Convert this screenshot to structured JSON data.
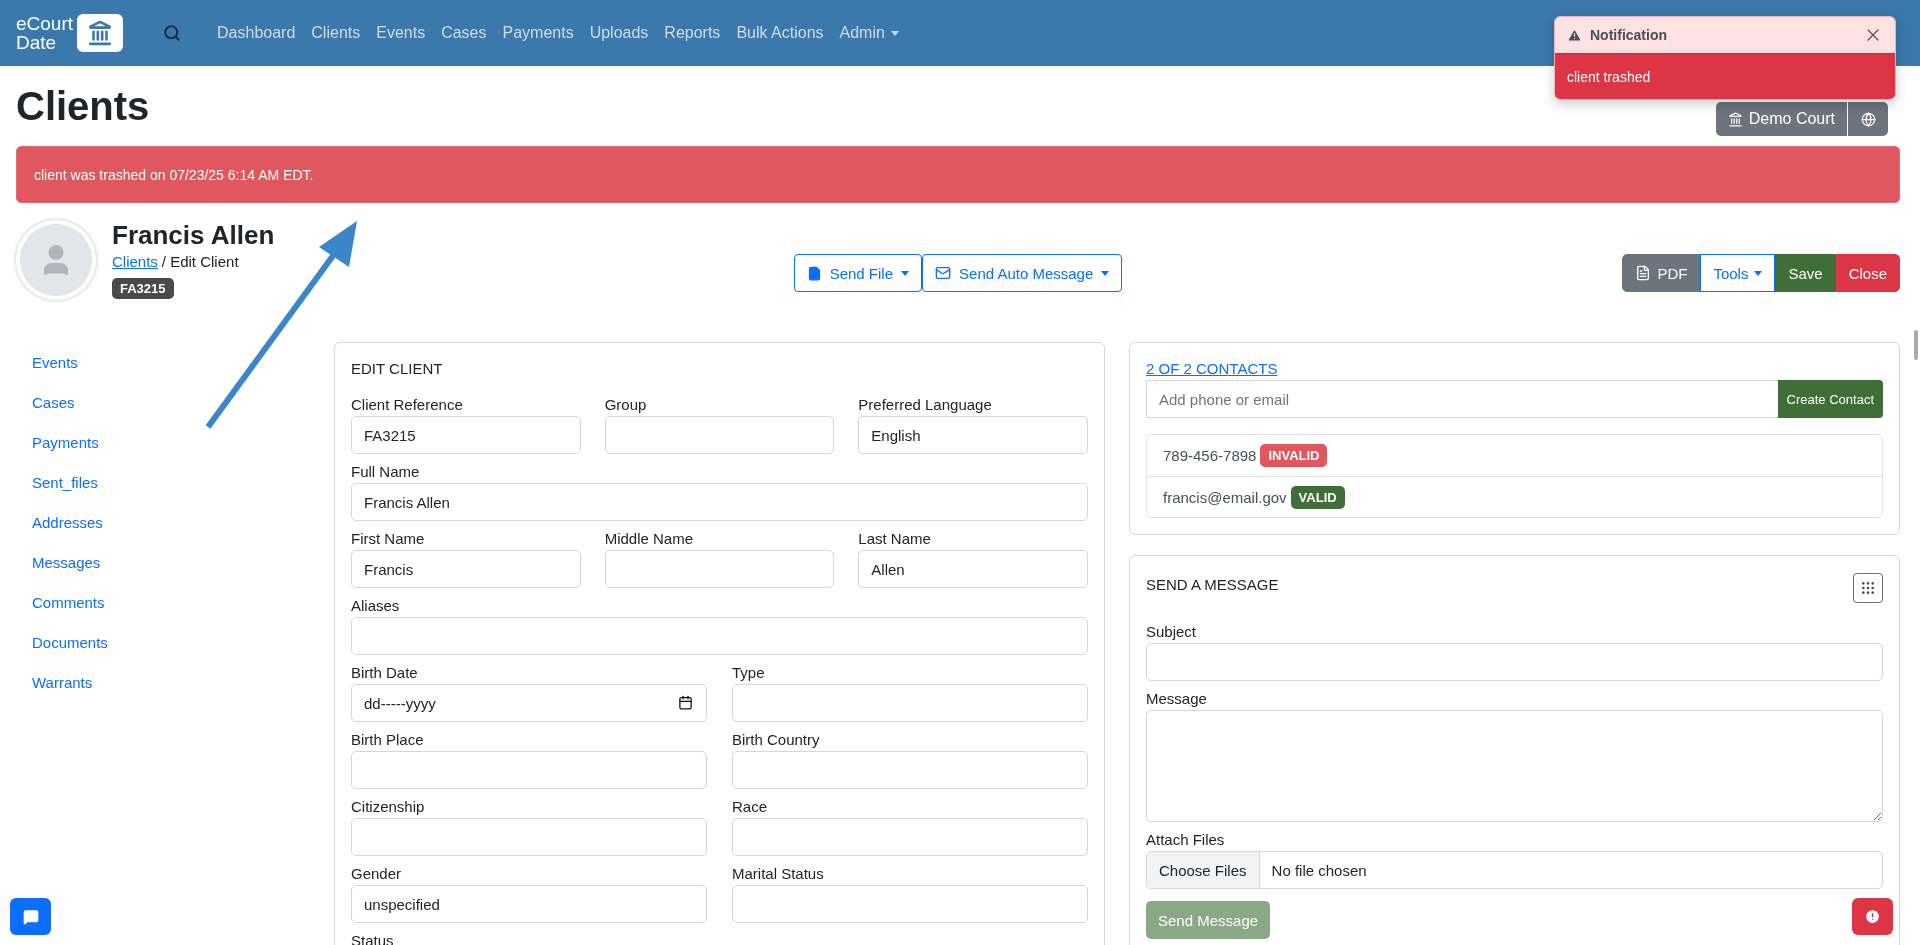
{
  "nav": {
    "brand_top": "eCourt",
    "brand_bottom": "Date",
    "links": [
      {
        "label": "Dashboard",
        "dropdown": false
      },
      {
        "label": "Clients",
        "dropdown": false
      },
      {
        "label": "Events",
        "dropdown": false
      },
      {
        "label": "Cases",
        "dropdown": false
      },
      {
        "label": "Payments",
        "dropdown": false
      },
      {
        "label": "Uploads",
        "dropdown": false
      },
      {
        "label": "Reports",
        "dropdown": false
      },
      {
        "label": "Bulk Actions",
        "dropdown": false
      },
      {
        "label": "Admin",
        "dropdown": true
      }
    ]
  },
  "page_title": "Clients",
  "court_button": {
    "label": "Demo Court"
  },
  "notification": {
    "title": "Notification",
    "message": "client trashed"
  },
  "alert": "client was trashed on 07/23/25 6:14 AM EDT.",
  "client": {
    "name": "Francis Allen",
    "breadcrumb_link": "Clients",
    "breadcrumb_rest": "/ Edit Client",
    "badge": "FA3215"
  },
  "center_actions": [
    {
      "label": "Send File",
      "kind": "file"
    },
    {
      "label": "Send Auto Message",
      "kind": "mail"
    }
  ],
  "right_actions": [
    {
      "label": "PDF",
      "kind": "pdf"
    },
    {
      "label": "Tools",
      "kind": "tools"
    },
    {
      "label": "Save",
      "kind": "save"
    },
    {
      "label": "Close",
      "kind": "close"
    }
  ],
  "sidebar": {
    "items": [
      {
        "label": "Events"
      },
      {
        "label": "Cases"
      },
      {
        "label": "Payments"
      },
      {
        "label": "Sent_files"
      },
      {
        "label": "Addresses"
      },
      {
        "label": "Messages"
      },
      {
        "label": "Comments"
      },
      {
        "label": "Documents"
      },
      {
        "label": "Warrants"
      }
    ]
  },
  "edit_form": {
    "title": "EDIT CLIENT",
    "rows": [
      {
        "fields": [
          {
            "label": "Client Reference",
            "value": "FA3215",
            "kind": "text"
          },
          {
            "label": "Group",
            "kind": "text"
          },
          {
            "label": "Preferred Language",
            "value": "English",
            "kind": "text"
          }
        ]
      },
      {
        "fields": [
          {
            "label": "Full Name",
            "value": "Francis Allen",
            "kind": "text"
          }
        ]
      },
      {
        "fields": [
          {
            "label": "First Name",
            "value": "Francis",
            "kind": "text"
          },
          {
            "label": "Middle Name",
            "kind": "text"
          },
          {
            "label": "Last Name",
            "value": "Allen",
            "kind": "text"
          }
        ]
      },
      {
        "fields": [
          {
            "label": "Aliases",
            "kind": "text"
          }
        ]
      },
      {
        "fields": [
          {
            "label": "Birth Date",
            "value": "dd-----yyyy",
            "kind": "date"
          },
          {
            "label": "Type",
            "kind": "text"
          }
        ]
      },
      {
        "fields": [
          {
            "label": "Birth Place",
            "kind": "text"
          },
          {
            "label": "Birth Country",
            "kind": "text"
          }
        ]
      },
      {
        "fields": [
          {
            "label": "Citizenship",
            "kind": "text"
          },
          {
            "label": "Race",
            "kind": "text"
          }
        ]
      },
      {
        "fields": [
          {
            "label": "Gender",
            "value": "unspecified",
            "kind": "text"
          },
          {
            "label": "Marital Status",
            "kind": "text"
          }
        ]
      }
    ],
    "last_label": "Status"
  },
  "contacts": {
    "title": "2 OF 2 CONTACTS",
    "placeholder": "Add phone or email",
    "button": "Create Contact",
    "items": [
      {
        "value": "789-456-7898",
        "status": "INVALID",
        "valid": false
      },
      {
        "value": "francis@email.gov",
        "status": "VALID",
        "valid": true
      }
    ]
  },
  "message": {
    "title": "SEND A MESSAGE",
    "subject_label": "Subject",
    "message_label": "Message",
    "attach_label": "Attach Files",
    "file_button": "Choose Files",
    "file_status": "No file chosen",
    "send_button": "Send Message",
    "send_disabled": true
  }
}
